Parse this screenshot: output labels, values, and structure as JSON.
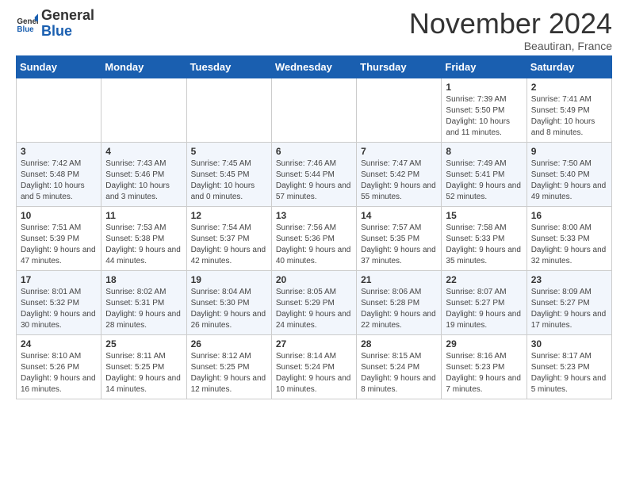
{
  "logo": {
    "general": "General",
    "blue": "Blue"
  },
  "title": "November 2024",
  "location": "Beautiran, France",
  "days_of_week": [
    "Sunday",
    "Monday",
    "Tuesday",
    "Wednesday",
    "Thursday",
    "Friday",
    "Saturday"
  ],
  "weeks": [
    [
      {
        "day": "",
        "info": ""
      },
      {
        "day": "",
        "info": ""
      },
      {
        "day": "",
        "info": ""
      },
      {
        "day": "",
        "info": ""
      },
      {
        "day": "",
        "info": ""
      },
      {
        "day": "1",
        "info": "Sunrise: 7:39 AM\nSunset: 5:50 PM\nDaylight: 10 hours and 11 minutes."
      },
      {
        "day": "2",
        "info": "Sunrise: 7:41 AM\nSunset: 5:49 PM\nDaylight: 10 hours and 8 minutes."
      }
    ],
    [
      {
        "day": "3",
        "info": "Sunrise: 7:42 AM\nSunset: 5:48 PM\nDaylight: 10 hours and 5 minutes."
      },
      {
        "day": "4",
        "info": "Sunrise: 7:43 AM\nSunset: 5:46 PM\nDaylight: 10 hours and 3 minutes."
      },
      {
        "day": "5",
        "info": "Sunrise: 7:45 AM\nSunset: 5:45 PM\nDaylight: 10 hours and 0 minutes."
      },
      {
        "day": "6",
        "info": "Sunrise: 7:46 AM\nSunset: 5:44 PM\nDaylight: 9 hours and 57 minutes."
      },
      {
        "day": "7",
        "info": "Sunrise: 7:47 AM\nSunset: 5:42 PM\nDaylight: 9 hours and 55 minutes."
      },
      {
        "day": "8",
        "info": "Sunrise: 7:49 AM\nSunset: 5:41 PM\nDaylight: 9 hours and 52 minutes."
      },
      {
        "day": "9",
        "info": "Sunrise: 7:50 AM\nSunset: 5:40 PM\nDaylight: 9 hours and 49 minutes."
      }
    ],
    [
      {
        "day": "10",
        "info": "Sunrise: 7:51 AM\nSunset: 5:39 PM\nDaylight: 9 hours and 47 minutes."
      },
      {
        "day": "11",
        "info": "Sunrise: 7:53 AM\nSunset: 5:38 PM\nDaylight: 9 hours and 44 minutes."
      },
      {
        "day": "12",
        "info": "Sunrise: 7:54 AM\nSunset: 5:37 PM\nDaylight: 9 hours and 42 minutes."
      },
      {
        "day": "13",
        "info": "Sunrise: 7:56 AM\nSunset: 5:36 PM\nDaylight: 9 hours and 40 minutes."
      },
      {
        "day": "14",
        "info": "Sunrise: 7:57 AM\nSunset: 5:35 PM\nDaylight: 9 hours and 37 minutes."
      },
      {
        "day": "15",
        "info": "Sunrise: 7:58 AM\nSunset: 5:33 PM\nDaylight: 9 hours and 35 minutes."
      },
      {
        "day": "16",
        "info": "Sunrise: 8:00 AM\nSunset: 5:33 PM\nDaylight: 9 hours and 32 minutes."
      }
    ],
    [
      {
        "day": "17",
        "info": "Sunrise: 8:01 AM\nSunset: 5:32 PM\nDaylight: 9 hours and 30 minutes."
      },
      {
        "day": "18",
        "info": "Sunrise: 8:02 AM\nSunset: 5:31 PM\nDaylight: 9 hours and 28 minutes."
      },
      {
        "day": "19",
        "info": "Sunrise: 8:04 AM\nSunset: 5:30 PM\nDaylight: 9 hours and 26 minutes."
      },
      {
        "day": "20",
        "info": "Sunrise: 8:05 AM\nSunset: 5:29 PM\nDaylight: 9 hours and 24 minutes."
      },
      {
        "day": "21",
        "info": "Sunrise: 8:06 AM\nSunset: 5:28 PM\nDaylight: 9 hours and 22 minutes."
      },
      {
        "day": "22",
        "info": "Sunrise: 8:07 AM\nSunset: 5:27 PM\nDaylight: 9 hours and 19 minutes."
      },
      {
        "day": "23",
        "info": "Sunrise: 8:09 AM\nSunset: 5:27 PM\nDaylight: 9 hours and 17 minutes."
      }
    ],
    [
      {
        "day": "24",
        "info": "Sunrise: 8:10 AM\nSunset: 5:26 PM\nDaylight: 9 hours and 16 minutes."
      },
      {
        "day": "25",
        "info": "Sunrise: 8:11 AM\nSunset: 5:25 PM\nDaylight: 9 hours and 14 minutes."
      },
      {
        "day": "26",
        "info": "Sunrise: 8:12 AM\nSunset: 5:25 PM\nDaylight: 9 hours and 12 minutes."
      },
      {
        "day": "27",
        "info": "Sunrise: 8:14 AM\nSunset: 5:24 PM\nDaylight: 9 hours and 10 minutes."
      },
      {
        "day": "28",
        "info": "Sunrise: 8:15 AM\nSunset: 5:24 PM\nDaylight: 9 hours and 8 minutes."
      },
      {
        "day": "29",
        "info": "Sunrise: 8:16 AM\nSunset: 5:23 PM\nDaylight: 9 hours and 7 minutes."
      },
      {
        "day": "30",
        "info": "Sunrise: 8:17 AM\nSunset: 5:23 PM\nDaylight: 9 hours and 5 minutes."
      }
    ]
  ]
}
